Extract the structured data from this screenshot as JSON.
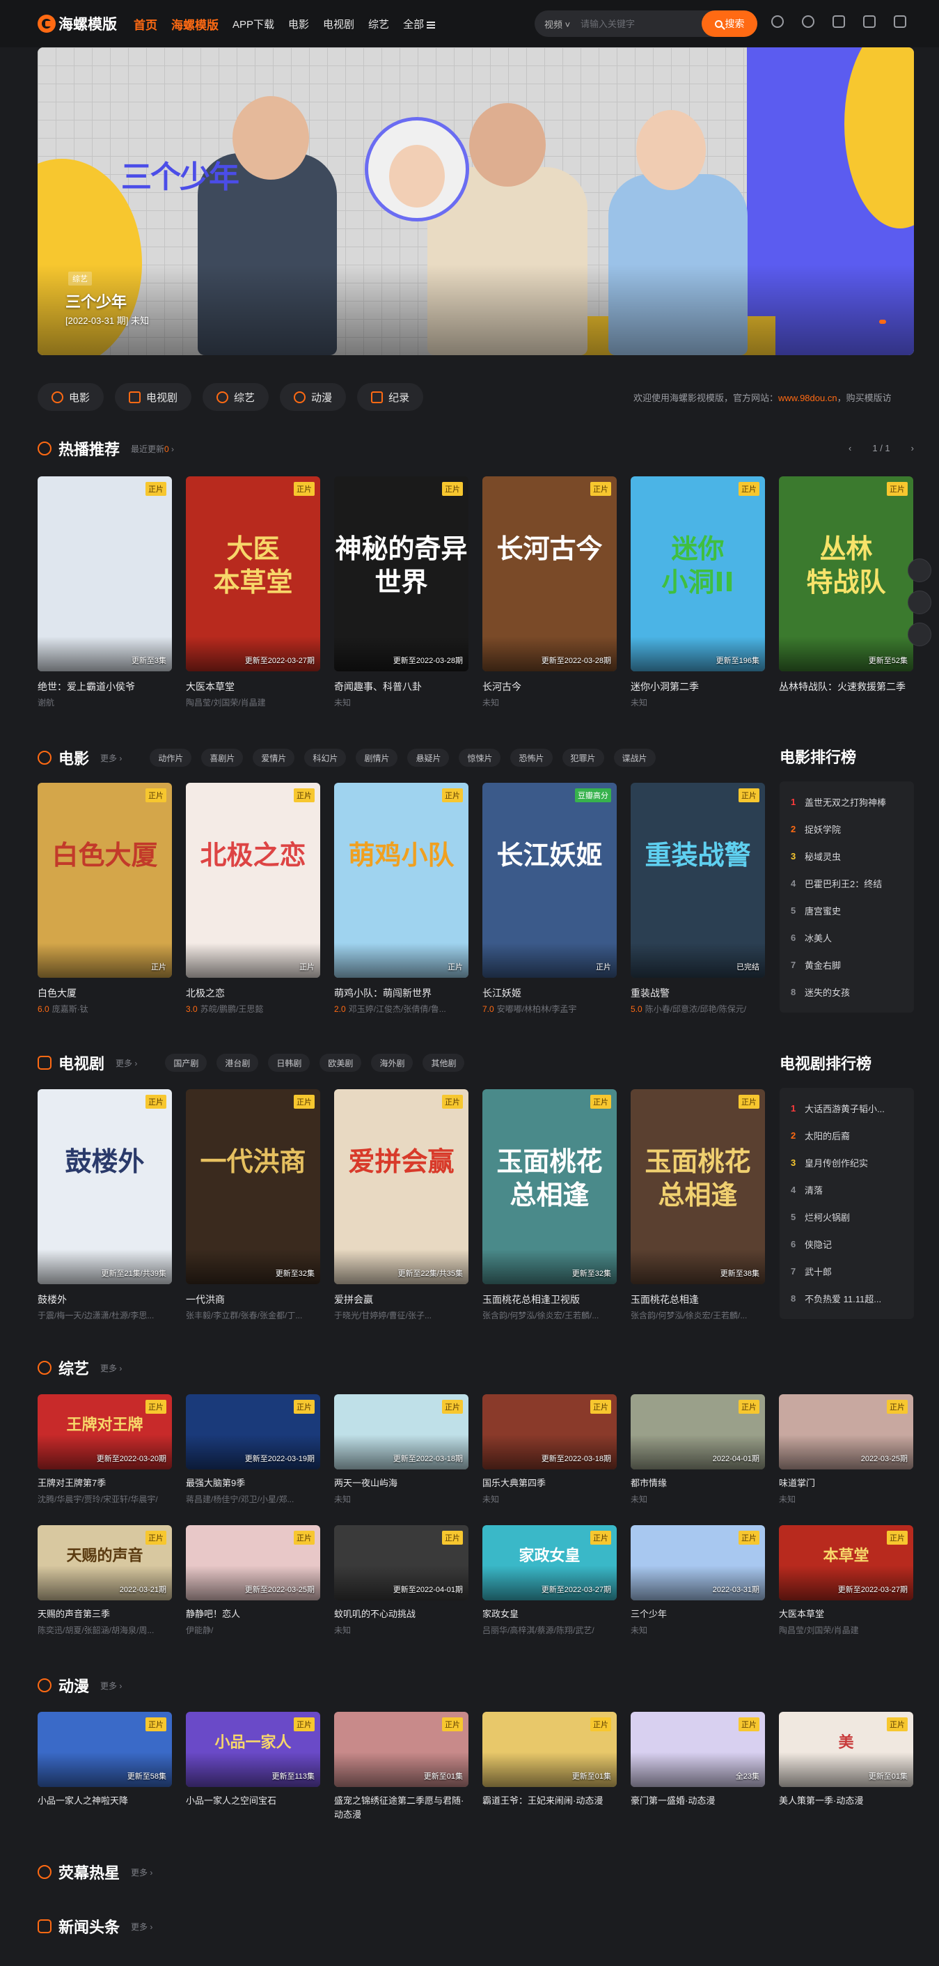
{
  "header": {
    "logo": "海螺模版",
    "nav": [
      "首页",
      "海螺模版",
      "APP下载",
      "电影",
      "电视剧",
      "综艺",
      "全部"
    ],
    "search_type": "视频",
    "search_placeholder": "请输入关键字",
    "search_button": "搜索",
    "icons": [
      "clock-icon",
      "wechat-icon",
      "tv-icon",
      "app-icon",
      "user-icon"
    ]
  },
  "banner": {
    "tag": "综艺",
    "title": "三个少年",
    "subtitle": "[2022-03-31 期] 未知",
    "art_logo": "三个少年"
  },
  "chips": [
    "电影",
    "电视剧",
    "综艺",
    "动漫",
    "纪录"
  ],
  "notice": {
    "text": "欢迎使用海螺影视模版，官方网站：",
    "url": "www.98dou.cn",
    "after": "，购买模版访"
  },
  "hot": {
    "title": "热播推荐",
    "more_prefix": "最近更新",
    "more_count": "0",
    "pager": "1 / 1",
    "items": [
      {
        "badge": "正片",
        "remark": "更新至3集",
        "title": "绝世：爱上霸道小侯爷",
        "meta": "谢航",
        "bg": "#dfe6ee",
        "fg": "#c23a2a",
        "art": ""
      },
      {
        "badge": "正片",
        "remark": "更新至2022-03-27期",
        "title": "大医本草堂",
        "meta": "陶昌莹/刘国荣/肖晶建",
        "bg": "#b82a1e",
        "fg": "#f7d76a",
        "art": "大医\n本草堂"
      },
      {
        "badge": "正片",
        "remark": "更新至2022-03-28期",
        "title": "奇闻趣事、科普八卦",
        "meta": "未知",
        "bg": "#1a1a1a",
        "fg": "#ffffff",
        "art": "神秘的奇异世界"
      },
      {
        "badge": "正片",
        "remark": "更新至2022-03-28期",
        "title": "长河古今",
        "meta": "未知",
        "bg": "#7a4a28",
        "fg": "#ffffff",
        "art": "长河古今"
      },
      {
        "badge": "正片",
        "remark": "更新至196集",
        "title": "迷你小洞第二季",
        "meta": "未知",
        "bg": "#4bb4e6",
        "fg": "#3fbf3f",
        "art": "迷你\n小洞II"
      },
      {
        "badge": "正片",
        "remark": "更新至52集",
        "title": "丛林特战队：火速救援第二季",
        "meta": "",
        "bg": "#3b7a2e",
        "fg": "#f7e36a",
        "art": "丛林\n特战队"
      }
    ]
  },
  "movie": {
    "title": "电影",
    "more": "更多",
    "tags": [
      "动作片",
      "喜剧片",
      "爱情片",
      "科幻片",
      "剧情片",
      "悬疑片",
      "惊悚片",
      "恐怖片",
      "犯罪片",
      "谍战片"
    ],
    "items": [
      {
        "badge": "正片",
        "badge_green": false,
        "remark": "正片",
        "title": "白色大厦",
        "score": "6.0",
        "meta": "庞嘉斯·钛",
        "bg": "#d4a64a",
        "fg": "#c23a2a",
        "art": "白色大厦"
      },
      {
        "badge": "正片",
        "badge_green": false,
        "remark": "正片",
        "title": "北极之恋",
        "score": "3.0",
        "meta": "苏皖/鹏鹏/王思懿",
        "bg": "#f4ebe6",
        "fg": "#d44",
        "art": "北极之恋"
      },
      {
        "badge": "正片",
        "badge_green": false,
        "remark": "正片",
        "title": "萌鸡小队：萌闯新世界",
        "score": "2.0",
        "meta": "邓玉婷/江俊杰/张倩倩/鲁...",
        "bg": "#9fd3ef",
        "fg": "#f0a020",
        "art": "萌鸡小队"
      },
      {
        "badge": "豆瓣高分",
        "badge_green": true,
        "remark": "正片",
        "title": "长江妖姬",
        "score": "7.0",
        "meta": "安嘟嘟/林柏林/李孟宇",
        "bg": "#3b5a8a",
        "fg": "#ffffff",
        "art": "长江妖姬"
      },
      {
        "badge": "正片",
        "badge_green": false,
        "remark": "已完结",
        "title": "重装战警",
        "score": "5.0",
        "meta": "陈小春/邱意浓/邱艳/陈保元/",
        "bg": "#2b3f52",
        "fg": "#5fd0f0",
        "art": "重装战警"
      }
    ],
    "rank_title": "电影排行榜",
    "rank": [
      "盖世无双之打狗神棒",
      "捉妖学院",
      "秘域灵虫",
      "巴霍巴利王2：终结",
      "唐宫蜜史",
      "冰美人",
      "黄金右脚",
      "迷失的女孩"
    ]
  },
  "tv": {
    "title": "电视剧",
    "more": "更多",
    "tags": [
      "国产剧",
      "港台剧",
      "日韩剧",
      "欧美剧",
      "海外剧",
      "其他剧"
    ],
    "items": [
      {
        "badge": "正片",
        "remark": "更新至21集/共39集",
        "title": "鼓楼外",
        "meta": "于震/梅一天/边潇潇/杜源/李思...",
        "bg": "#e8edf3",
        "fg": "#2a3a6a",
        "art": "鼓楼外"
      },
      {
        "badge": "正片",
        "remark": "更新至32集",
        "title": "一代洪商",
        "meta": "张丰毅/李立群/张春/张金都/丁...",
        "bg": "#3a2a1e",
        "fg": "#e6c060",
        "art": "一代洪商"
      },
      {
        "badge": "正片",
        "remark": "更新至22集/共35集",
        "title": "爱拼会赢",
        "meta": "于晓光/甘婷婷/曹征/张子...",
        "bg": "#e8d9c2",
        "fg": "#d83a2a",
        "art": "爱拼会赢"
      },
      {
        "badge": "正片",
        "remark": "更新至32集",
        "title": "玉面桃花总相逢卫视版",
        "meta": "张含韵/何梦泓/徐炎宏/王若麟/...",
        "bg": "#4a8a8a",
        "fg": "#ffffff",
        "art": "玉面桃花\n总相逢"
      },
      {
        "badge": "正片",
        "remark": "更新至38集",
        "title": "玉面桃花总相逢",
        "meta": "张含韵/何梦泓/徐炎宏/王若麟/...",
        "bg": "#5a4030",
        "fg": "#f0d070",
        "art": "玉面桃花\n总相逢"
      }
    ],
    "rank_title": "电视剧排行榜",
    "rank": [
      "大话西游黄子韬小...",
      "太阳的后裔",
      "皇月传创作纪实",
      "清落",
      "烂柯火锅剧",
      "侠隐记",
      "武十郎",
      "不负热爱 11.11超..."
    ]
  },
  "variety": {
    "title": "综艺",
    "more": "更多",
    "items": [
      {
        "badge": "正片",
        "remark": "更新至2022-03-20期",
        "title": "王牌对王牌第7季",
        "meta": "沈腾/华晨宇/贾玲/宋亚轩/华晨宇/",
        "bg": "#c82a2a",
        "fg": "#f7d76a",
        "art": "王牌对王牌"
      },
      {
        "badge": "正片",
        "remark": "更新至2022-03-19期",
        "title": "最强大脑第9季",
        "meta": "蒋昌建/杨佳宁/邓卫/小星/郑...",
        "bg": "#1a3a7a",
        "fg": "#ffffff",
        "art": ""
      },
      {
        "badge": "正片",
        "remark": "更新至2022-03-18期",
        "title": "两天一夜山屿海",
        "meta": "未知",
        "bg": "#bfe0e8",
        "fg": "#3a8a3a",
        "art": ""
      },
      {
        "badge": "正片",
        "remark": "更新至2022-03-18期",
        "title": "国乐大典第四季",
        "meta": "未知",
        "bg": "#8a3a2a",
        "fg": "#ffffff",
        "art": ""
      },
      {
        "badge": "正片",
        "remark": "2022-04-01期",
        "title": "都市情缘",
        "meta": "未知",
        "bg": "#9aa08a",
        "fg": "#ffffff",
        "art": ""
      },
      {
        "badge": "正片",
        "remark": "2022-03-25期",
        "title": "味道掌门",
        "meta": "未知",
        "bg": "#c8a8a0",
        "fg": "#ffffff",
        "art": ""
      },
      {
        "badge": "正片",
        "remark": "2022-03-21期",
        "title": "天赐的声音第三季",
        "meta": "陈奕迅/胡夏/张韶涵/胡海泉/周...",
        "bg": "#d8c8a0",
        "fg": "#5a3a10",
        "art": "天赐的声音"
      },
      {
        "badge": "正片",
        "remark": "更新至2022-03-25期",
        "title": "静静吧！恋人",
        "meta": "伊能静/",
        "bg": "#e8c8c8",
        "fg": "#ffffff",
        "art": ""
      },
      {
        "badge": "正片",
        "remark": "更新至2022-04-01期",
        "title": "蚊叽叽的不心动挑战",
        "meta": "未知",
        "bg": "#3a3a3a",
        "fg": "#ffffff",
        "art": ""
      },
      {
        "badge": "正片",
        "remark": "更新至2022-03-27期",
        "title": "家政女皇",
        "meta": "吕丽华/高梓淇/蔡源/陈翔/武艺/",
        "bg": "#3ab8c8",
        "fg": "#ffffff",
        "art": "家政女皇"
      },
      {
        "badge": "正片",
        "remark": "2022-03-31期",
        "title": "三个少年",
        "meta": "未知",
        "bg": "#a8c8f0",
        "fg": "#4b4de8",
        "art": ""
      },
      {
        "badge": "正片",
        "remark": "更新至2022-03-27期",
        "title": "大医本草堂",
        "meta": "陶昌莹/刘国荣/肖晶建",
        "bg": "#b82a1e",
        "fg": "#f7d76a",
        "art": "本草堂"
      }
    ]
  },
  "anime": {
    "title": "动漫",
    "more": "更多",
    "items": [
      {
        "badge": "正片",
        "remark": "更新至58集",
        "title": "小品一家人之神啦天降",
        "bg": "#3a6ac8",
        "fg": "#ffffff",
        "art": ""
      },
      {
        "badge": "正片",
        "remark": "更新至113集",
        "title": "小品一家人之空间宝石",
        "bg": "#6a4ac8",
        "fg": "#f7d76a",
        "art": "小品一家人"
      },
      {
        "badge": "正片",
        "remark": "更新至01集",
        "title": "盛宠之锦绣征途第二季愿与君随·动态漫",
        "bg": "#c88a8a",
        "fg": "#ffffff",
        "art": ""
      },
      {
        "badge": "正片",
        "remark": "更新至01集",
        "title": "霸道王爷：王妃来闹闹·动态漫",
        "bg": "#e8c86a",
        "fg": "#ffffff",
        "art": ""
      },
      {
        "badge": "正片",
        "remark": "全23集",
        "title": "豪门第一盛婚·动态漫",
        "bg": "#d8d0f0",
        "fg": "#ffffff",
        "art": ""
      },
      {
        "badge": "正片",
        "remark": "更新至01集",
        "title": "美人策第一季·动态漫",
        "bg": "#f0e8e0",
        "fg": "#c83a3a",
        "art": "美"
      }
    ]
  },
  "hot_screen": {
    "title": "荧幕热星",
    "more": "更多"
  },
  "news": {
    "title": "新闻头条",
    "more": "更多"
  }
}
